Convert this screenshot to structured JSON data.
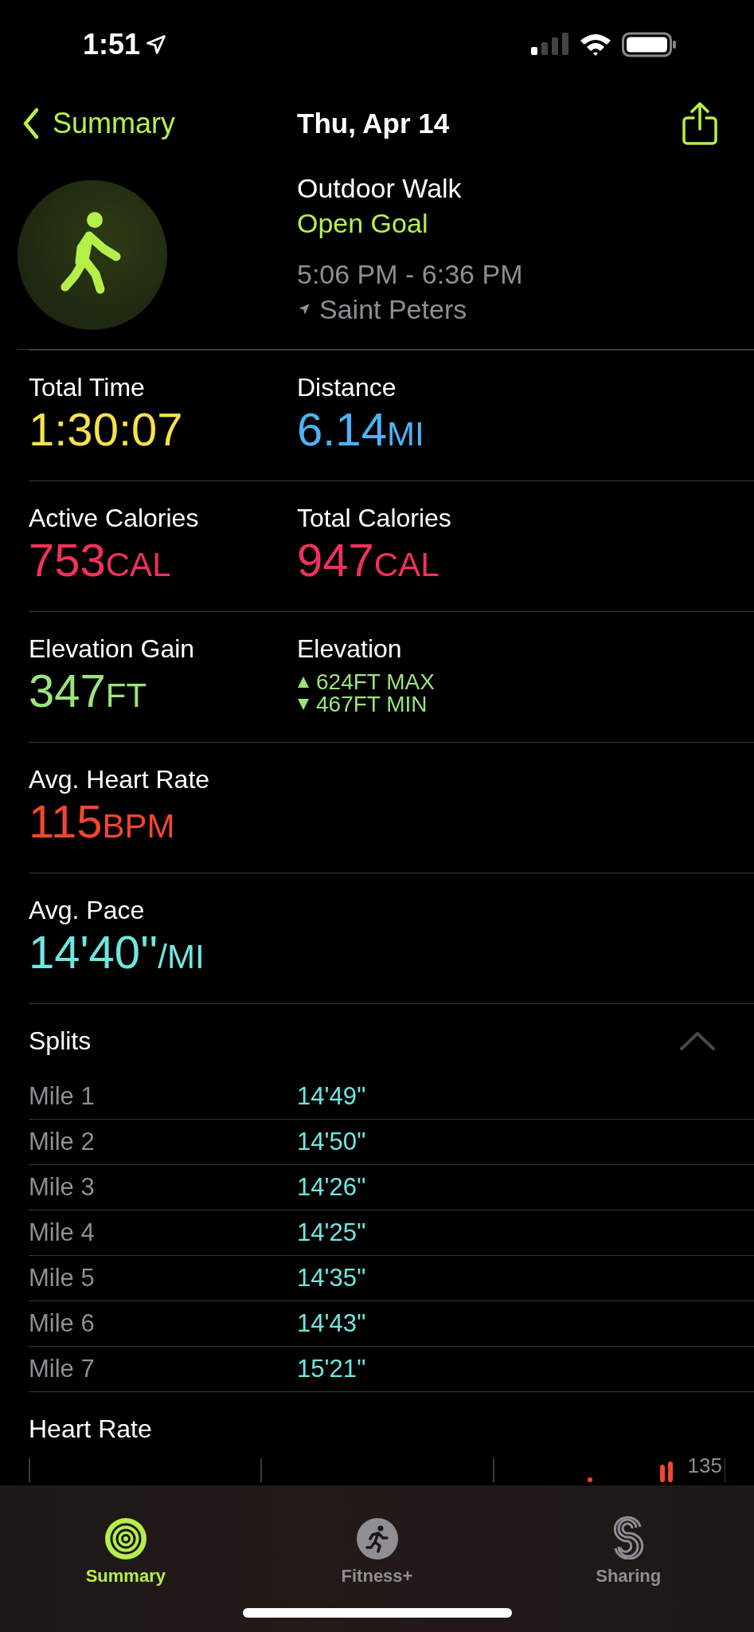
{
  "status_bar": {
    "time": "1:51"
  },
  "nav": {
    "back": "Summary",
    "title": "Thu, Apr 14"
  },
  "workout": {
    "name": "Outdoor Walk",
    "goal": "Open Goal",
    "time_range": "5:06 PM - 6:36 PM",
    "location": "Saint Peters"
  },
  "metric_rows": [
    [
      {
        "kind": "stat",
        "label": "Total Time",
        "value": "1:30:07",
        "color": "#f6e14b"
      },
      {
        "kind": "stat",
        "label": "Distance",
        "value": "6.14",
        "unit": "MI",
        "color": "#4db3f5"
      }
    ],
    [
      {
        "kind": "stat",
        "label": "Active Calories",
        "value": "753",
        "unit": "CAL",
        "color": "#f2315b"
      },
      {
        "kind": "stat",
        "label": "Total Calories",
        "value": "947",
        "unit": "CAL",
        "color": "#f2315b"
      }
    ],
    [
      {
        "kind": "stat",
        "label": "Elevation Gain",
        "value": "347",
        "unit": "FT",
        "color": "#9ce37c"
      },
      {
        "kind": "range",
        "label": "Elevation",
        "max": "624FT MAX",
        "min": "467FT MIN",
        "color": "#9ce37c"
      }
    ],
    [
      {
        "kind": "stat",
        "label": "Avg. Heart Rate",
        "value": "115",
        "unit": "BPM",
        "color": "#f4462f"
      }
    ],
    [
      {
        "kind": "stat",
        "label": "Avg. Pace",
        "value": "14'40''",
        "unit": "/MI",
        "color": "#6fe7e1"
      }
    ]
  ],
  "splits": {
    "title": "Splits",
    "expanded": true,
    "rows": [
      {
        "label": "Mile 1",
        "pace": "14'49''"
      },
      {
        "label": "Mile 2",
        "pace": "14'50''"
      },
      {
        "label": "Mile 3",
        "pace": "14'26''"
      },
      {
        "label": "Mile 4",
        "pace": "14'25''"
      },
      {
        "label": "Mile 5",
        "pace": "14'35''"
      },
      {
        "label": "Mile 6",
        "pace": "14'43''"
      },
      {
        "label": "Mile 7",
        "pace": "15'21''"
      }
    ]
  },
  "heart_rate": {
    "title": "Heart Rate",
    "max_label": "135"
  },
  "tabs": [
    {
      "label": "Summary",
      "kind": "rings",
      "selected": true
    },
    {
      "label": "Fitness+",
      "kind": "runner",
      "selected": false
    },
    {
      "label": "Sharing",
      "kind": "sharing",
      "selected": false
    }
  ]
}
